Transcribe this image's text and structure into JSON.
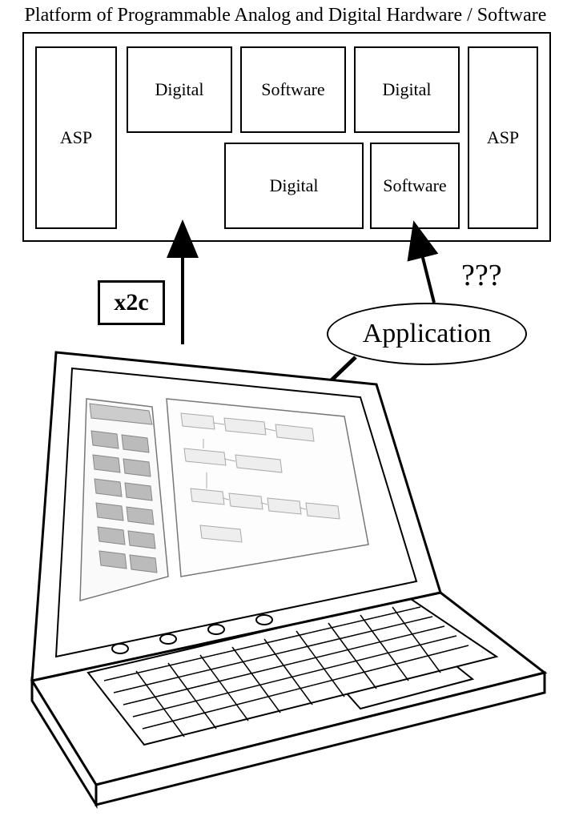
{
  "title": "Platform of Programmable Analog and Digital Hardware / Software",
  "platform": {
    "asp_left": "ASP",
    "asp_right": "ASP",
    "top_row": {
      "digital1": "Digital",
      "software": "Software",
      "digital2": "Digital"
    },
    "bottom_row": {
      "digital": "Digital",
      "software": "Software"
    }
  },
  "x2c_label": "x2c",
  "question_marks": "???",
  "application_label": "Application"
}
